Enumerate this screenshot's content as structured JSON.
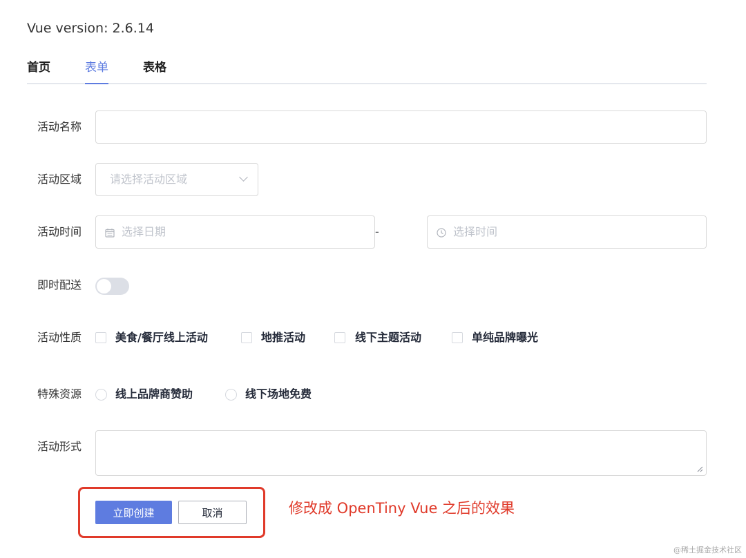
{
  "app": {
    "version_text": "Vue version: 2.6.14"
  },
  "tabs": [
    {
      "label": "首页",
      "active": false
    },
    {
      "label": "表单",
      "active": true
    },
    {
      "label": "表格",
      "active": false
    }
  ],
  "form": {
    "name": {
      "label": "活动名称",
      "value": ""
    },
    "region": {
      "label": "活动区域",
      "placeholder": "请选择活动区域",
      "icon": "chevron-down-icon"
    },
    "time": {
      "label": "活动时间",
      "date_placeholder": "选择日期",
      "date_icon": "calendar-icon",
      "separator": "-",
      "time_placeholder": "选择时间",
      "time_icon": "clock-icon"
    },
    "delivery": {
      "label": "即时配送",
      "on": false
    },
    "type": {
      "label": "活动性质",
      "options": [
        "美食/餐厅线上活动",
        "地推活动",
        "线下主题活动",
        "单纯品牌曝光"
      ]
    },
    "resource": {
      "label": "特殊资源",
      "options": [
        "线上品牌商赞助",
        "线下场地免费"
      ]
    },
    "desc": {
      "label": "活动形式",
      "value": ""
    }
  },
  "actions": {
    "create_label": "立即创建",
    "cancel_label": "取消"
  },
  "annotation": "修改成 OpenTiny Vue 之后的效果",
  "watermark": "@稀土掘金技术社区",
  "colors": {
    "primary": "#5e7ce0",
    "annotation_red": "#e03a2a",
    "border": "#d9d9d9"
  }
}
